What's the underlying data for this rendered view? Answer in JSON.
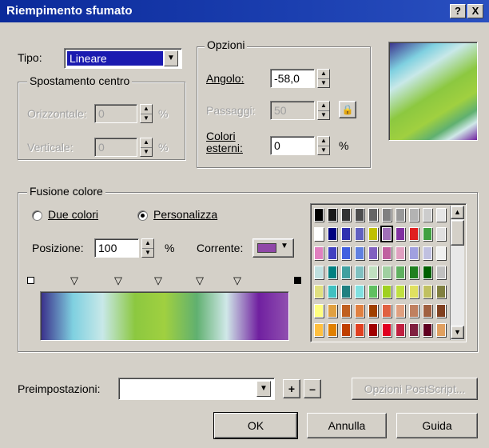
{
  "window": {
    "title": "Riempimento sfumato",
    "help_label": "?",
    "close_label": "X"
  },
  "type": {
    "label": "Tipo:",
    "value": "Lineare"
  },
  "center_offset": {
    "title": "Spostamento centro",
    "horizontal_label": "Orizzontale:",
    "horizontal_value": "0",
    "vertical_label": "Verticale:",
    "vertical_value": "0",
    "unit": "%"
  },
  "options": {
    "title": "Opzioni",
    "angle_label": "Angolo:",
    "angle_value": "-58,0",
    "steps_label": "Passaggi:",
    "steps_value": "50",
    "edge_label_1": "Colori",
    "edge_label_2": "esterni:",
    "edge_value": "0",
    "unit": "%"
  },
  "blend": {
    "title": "Fusione colore",
    "radio_two_colors": "Due colori",
    "radio_custom": "Personalizza",
    "selected_mode": "Personalizza",
    "position_label": "Posizione:",
    "position_value": "100",
    "position_unit": "%",
    "current_label": "Corrente:",
    "current_color": "#9048a8",
    "gradient_colors": [
      "#3a2e8a",
      "#7fd0e0",
      "#c8e8e8",
      "#8cc840",
      "#a0d040",
      "#60b070",
      "#d0e8e8",
      "#7020a0",
      "#9050b0"
    ]
  },
  "palette": {
    "selected_color": "#a070b8",
    "swatches": [
      "#000000",
      "#1a1a1a",
      "#333333",
      "#4d4d4d",
      "#666666",
      "#808080",
      "#999999",
      "#b3b3b3",
      "#cccccc",
      "#e6e6e6",
      "#ffffff",
      "#000080",
      "#3030b0",
      "#6060c0",
      "#c0c000",
      "#a070b8",
      "#8030a0",
      "#e02020",
      "#40a040",
      "#e0e0e0",
      "#e080c0",
      "#4040c0",
      "#4060e0",
      "#6080e0",
      "#8060c0",
      "#c060a0",
      "#e0a0c0",
      "#a0a0e0",
      "#c0c0e0",
      "#f0f0f0",
      "#c0e0e0",
      "#008080",
      "#40a0a0",
      "#80c0c0",
      "#c0e0c0",
      "#a0d0a0",
      "#60b060",
      "#208020",
      "#006000",
      "#c0c0c0",
      "#e0e080",
      "#40c0c0",
      "#208080",
      "#80e0e0",
      "#60c060",
      "#a0d020",
      "#c0e040",
      "#e0e060",
      "#c0c060",
      "#808040",
      "#ffff80",
      "#e0a040",
      "#c06020",
      "#e08040",
      "#a04000",
      "#e06040",
      "#e0a080",
      "#c08060",
      "#a06040",
      "#804020",
      "#ffc040",
      "#e08000",
      "#c04000",
      "#e04020",
      "#a00000",
      "#e00020",
      "#c02040",
      "#802040",
      "#600020",
      "#e0a060"
    ]
  },
  "presets": {
    "label": "Preimpostazioni:",
    "value": "",
    "add_label": "+",
    "remove_label": "–",
    "postscript_label": "Opzioni PostScript..."
  },
  "buttons": {
    "ok": "OK",
    "cancel": "Annulla",
    "help": "Guida"
  }
}
